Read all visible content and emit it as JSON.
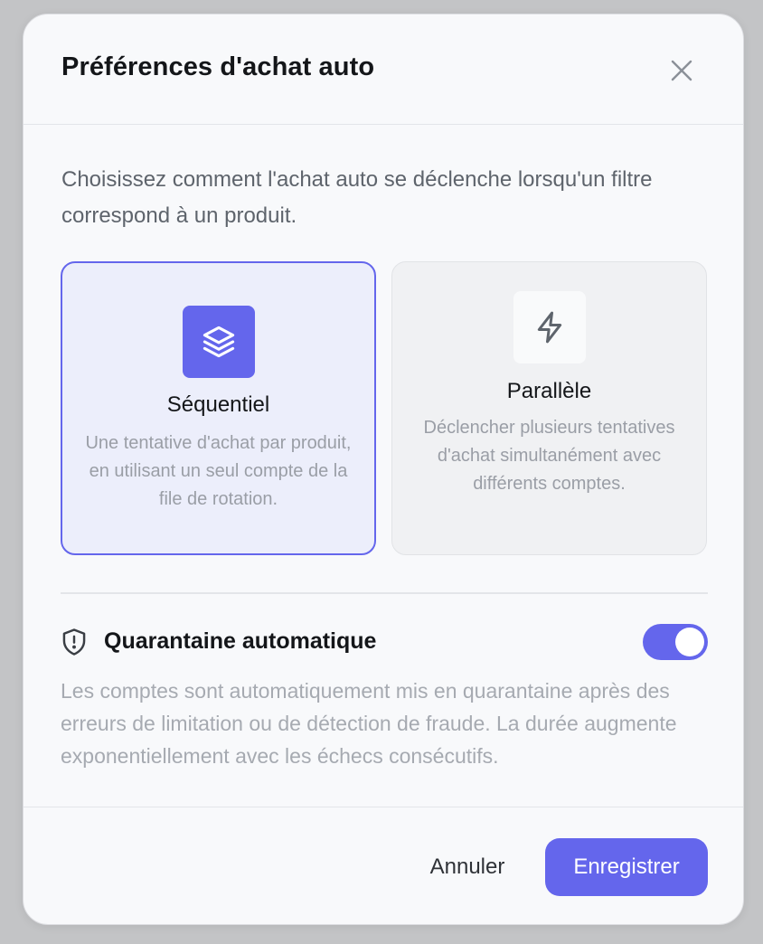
{
  "dialog": {
    "title": "Préférences d'achat auto",
    "intro": "Choisissez comment l'achat auto se déclenche lorsqu'un filtre correspond à un produit."
  },
  "modes": [
    {
      "title": "Séquentiel",
      "description": "Une tentative d'achat par produit, en utilisant un seul compte de la file de rotation.",
      "selected": true,
      "icon": "layers-icon"
    },
    {
      "title": "Parallèle",
      "description": "Déclencher plusieurs tentatives d'achat simultanément avec différents comptes.",
      "selected": false,
      "icon": "lightning-icon"
    }
  ],
  "quarantine": {
    "title": "Quarantaine automatique",
    "enabled": true,
    "description": "Les comptes sont automatiquement mis en quarantaine après des erreurs de limitation ou de détection de fraude. La durée augmente exponentiellement avec les échecs consécutifs."
  },
  "footer": {
    "cancel_label": "Annuler",
    "save_label": "Enregistrer"
  },
  "colors": {
    "accent": "#6466ec",
    "selected_card_bg": "#eceefb"
  }
}
